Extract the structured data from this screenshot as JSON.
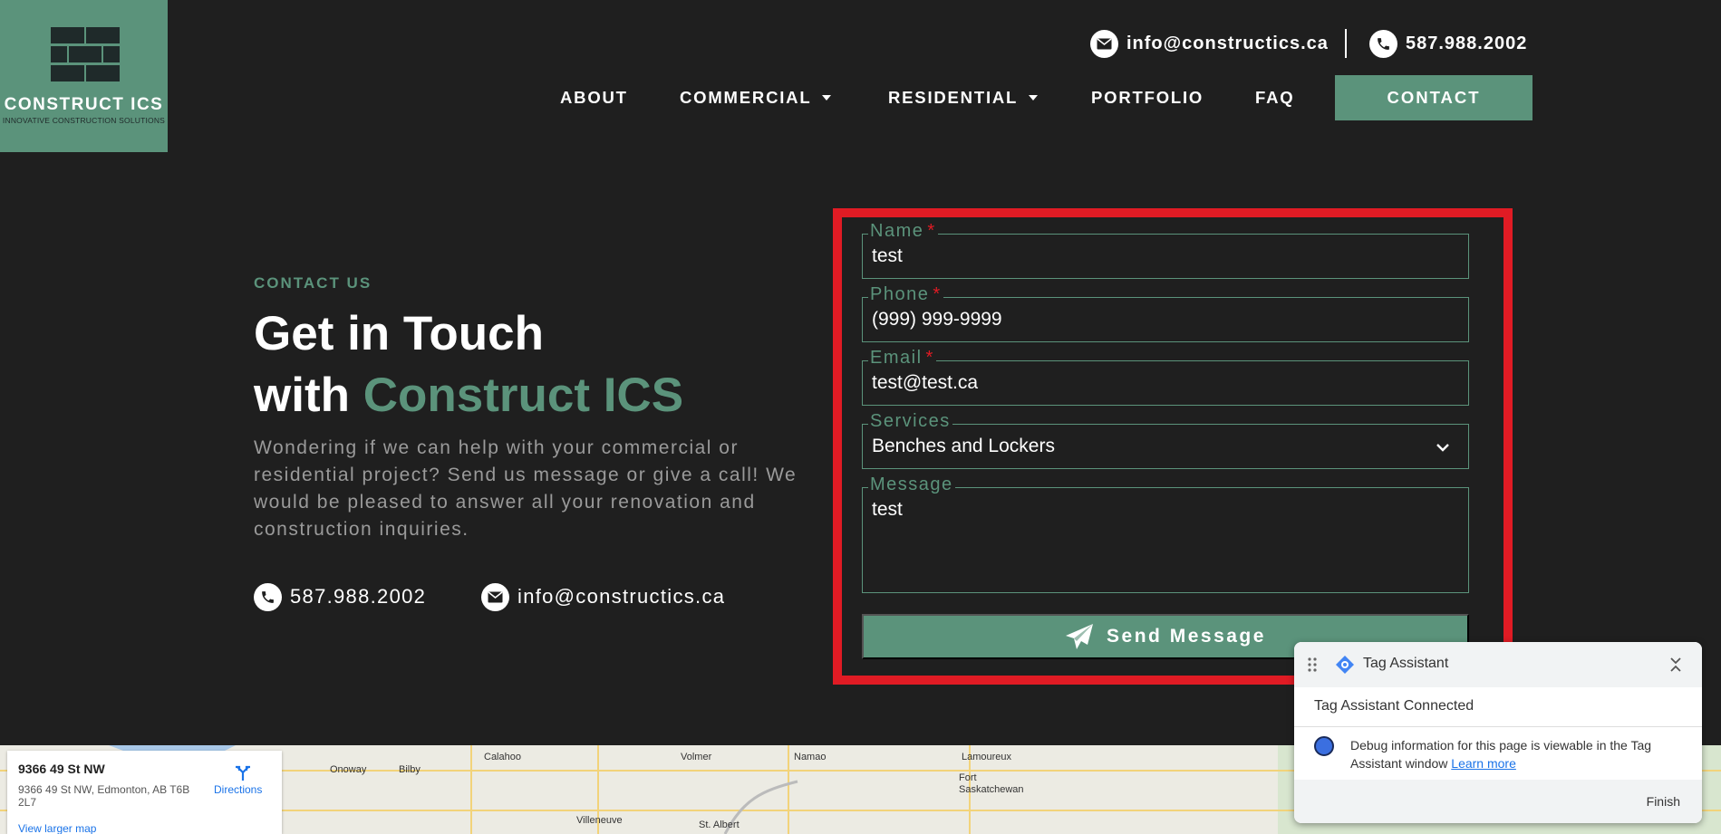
{
  "brand": {
    "name": "CONSTRUCT ICS",
    "tagline": "INNOVATIVE CONSTRUCTION SOLUTIONS",
    "accent_color": "#5b937b",
    "background_color": "#1f1f1f"
  },
  "topbar": {
    "email": "info@constructics.ca",
    "phone": "587.988.2002"
  },
  "nav": {
    "items": [
      {
        "label": "ABOUT"
      },
      {
        "label": "COMMERCIAL"
      },
      {
        "label": "RESIDENTIAL"
      },
      {
        "label": "PORTFOLIO"
      },
      {
        "label": "FAQ"
      }
    ],
    "cta": "CONTACT"
  },
  "hero": {
    "eyebrow": "CONTACT US",
    "title_line1": "Get in Touch",
    "title_line2_prefix": "with ",
    "title_line2_accent": "Construct ICS",
    "lead": "Wondering if we can help with your commercial or residential project? Send us message or give a call! We would be pleased to answer all your renovation and construction inquiries.",
    "phone": "587.988.2002",
    "email": "info@constructics.ca"
  },
  "form": {
    "fields": [
      {
        "label": "Name",
        "required_mark": "*",
        "value": "test"
      },
      {
        "label": "Phone",
        "required_mark": "*",
        "value": "(999) 999-9999"
      },
      {
        "label": "Email",
        "required_mark": "*",
        "value": "test@test.ca"
      },
      {
        "label": "Services",
        "required_mark": "",
        "value": "Benches and Lockers"
      },
      {
        "label": "Message",
        "required_mark": "",
        "value": "test"
      }
    ],
    "submit": "Send Message",
    "highlight_color": "#e01b24"
  },
  "map": {
    "card_title": "9366 49 St NW",
    "card_address": "9366 49 St NW, Edmonton, AB T6B 2L7",
    "directions": "Directions",
    "larger_map": "View larger map",
    "places": [
      "Onoway",
      "Bilby",
      "Calahoo",
      "Volmer",
      "Namao",
      "Lamoureux",
      "Fort Saskatchewan",
      "Villeneuve",
      "St. Albert"
    ]
  },
  "tag_assistant": {
    "title": "Tag Assistant",
    "status": "Tag Assistant Connected",
    "message": "Debug information for this page is viewable in the Tag Assistant window",
    "learn_more": "Learn more",
    "finish": "Finish"
  }
}
